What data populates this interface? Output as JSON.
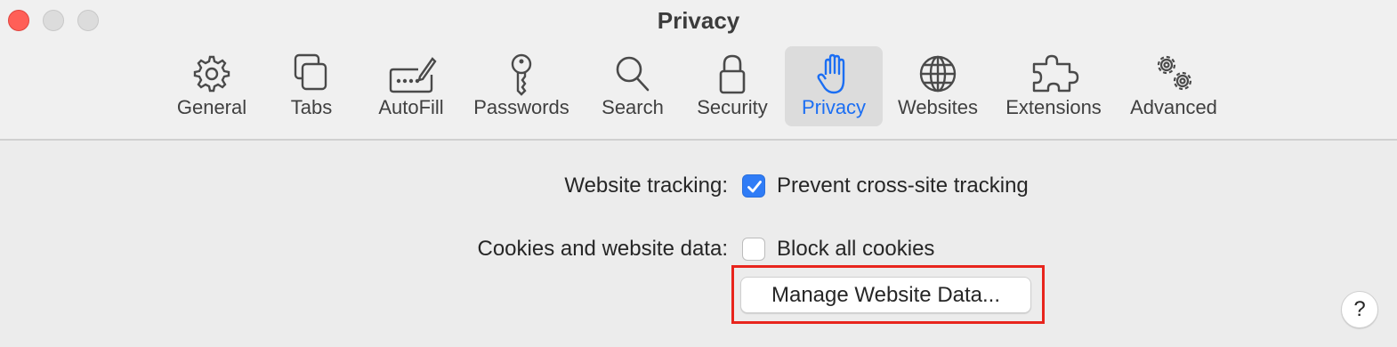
{
  "window": {
    "title": "Privacy",
    "controls": [
      "close",
      "minimize",
      "zoom"
    ]
  },
  "toolbar": {
    "items": [
      {
        "label": "General",
        "icon": "gear-icon",
        "active": false
      },
      {
        "label": "Tabs",
        "icon": "tabs-icon",
        "active": false
      },
      {
        "label": "AutoFill",
        "icon": "autofill-icon",
        "active": false
      },
      {
        "label": "Passwords",
        "icon": "key-icon",
        "active": false
      },
      {
        "label": "Search",
        "icon": "magnifier-icon",
        "active": false
      },
      {
        "label": "Security",
        "icon": "lock-icon",
        "active": false
      },
      {
        "label": "Privacy",
        "icon": "hand-icon",
        "active": true
      },
      {
        "label": "Websites",
        "icon": "globe-icon",
        "active": false
      },
      {
        "label": "Extensions",
        "icon": "puzzle-icon",
        "active": false
      },
      {
        "label": "Advanced",
        "icon": "gears-icon",
        "active": false
      }
    ]
  },
  "settings": {
    "tracking": {
      "label": "Website tracking:",
      "option": "Prevent cross-site tracking",
      "checked": true
    },
    "cookies": {
      "label": "Cookies and website data:",
      "option": "Block all cookies",
      "checked": false,
      "button": "Manage Website Data..."
    }
  },
  "help": {
    "label": "?"
  },
  "colors": {
    "accent": "#2f7cf6",
    "active_label": "#1b6ef3",
    "highlight": "#e8251d",
    "close": "#ff5f57"
  }
}
